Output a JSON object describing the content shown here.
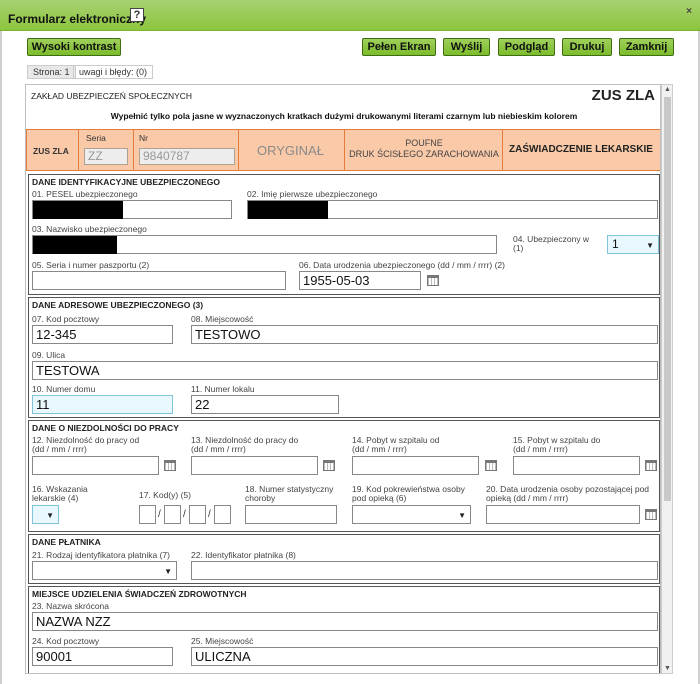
{
  "window": {
    "title": "Formularz elektroniczny",
    "help": "?",
    "close": "×"
  },
  "toolbar": {
    "high_contrast": "Wysoki kontrast",
    "fullscreen": "Pełen Ekran",
    "send": "Wyślij",
    "preview": "Podgląd",
    "print": "Drukuj",
    "close": "Zamknij"
  },
  "tabs": {
    "page": "Strona: 1",
    "errors": "uwagi i błędy: (0)"
  },
  "doc": {
    "institution": "ZAKŁAD UBEZPIECZEŃ SPOŁECZNYCH",
    "form_code": "ZUS ZLA",
    "instruction": "Wypełnić tylko pola jasne w wyznaczonych kratkach dużymi drukowanymi literami czarnym lub niebieskim kolorem"
  },
  "band": {
    "code": "ZUS ZLA",
    "seria_label": "Seria",
    "seria_value": "ZZ",
    "nr_label": "Nr",
    "nr_value": "9840787",
    "original": "ORYGINAŁ",
    "confidential_1": "POUFNE",
    "confidential_2": "DRUK ŚCISŁEGO ZARACHOWANIA",
    "certificate": "ZAŚWIADCZENIE LEKARSKIE"
  },
  "s1": {
    "title": "DANE IDENTYFIKACYJNE UBEZPIECZONEGO",
    "f01": "01. PESEL ubezpieczonego",
    "f02": "02. Imię pierwsze ubezpieczonego",
    "f03": "03. Nazwisko ubezpieczonego",
    "f04": "04. Ubezpieczony w (1)",
    "f04_value": "1",
    "f05": "05. Seria i numer paszportu (2)",
    "f06": "06. Data urodzenia ubezpieczonego (dd / mm / rrrr) (2)",
    "f06_value": "1955-05-03"
  },
  "s2": {
    "title": "DANE ADRESOWE UBEZPIECZONEGO (3)",
    "f07": "07. Kod pocztowy",
    "f07_value": "12-345",
    "f08": "08. Miejscowość",
    "f08_value": "TESTOWO",
    "f09": "09. Ulica",
    "f09_value": "TESTOWA",
    "f10": "10. Numer domu",
    "f10_value": "11",
    "f11": "11. Numer lokalu",
    "f11_value": "22"
  },
  "s3": {
    "title": "DANE O NIEZDOLNOŚCI DO PRACY",
    "f12a": "12. Niezdolność do pracy od",
    "f12b": "(dd / mm / rrrr)",
    "f13a": "13. Niezdolność do pracy do",
    "f13b": "(dd / mm / rrrr)",
    "f14a": "14. Pobyt w szpitalu od",
    "f14b": "(dd / mm / rrrr)",
    "f15a": "15. Pobyt w szpitalu do",
    "f15b": "(dd / mm / rrrr)",
    "f16a": "16. Wskazania",
    "f16b": "lekarskie (4)",
    "f17": "17. Kod(y) (5)",
    "f18a": "18. Numer statystyczny",
    "f18b": "choroby",
    "f19a": "19. Kod pokrewieństwa osoby",
    "f19b": "pod opieką (6)",
    "f20a": "20. Data urodzenia osoby pozostającej pod",
    "f20b": "opieką (dd / mm / rrrr)"
  },
  "s4": {
    "title": "DANE PŁATNIKA",
    "f21": "21. Rodzaj identyfikatora płatnika (7)",
    "f22": "22. Identyfikator płatnika (8)"
  },
  "s5": {
    "title": "MIEJSCE UDZIELENIA ŚWIADCZEŃ ZDROWOTNYCH",
    "f23": "23. Nazwa skrócona",
    "f23_value": "NAZWA NZZ",
    "f24": "24. Kod pocztowy",
    "f24_value": "90001",
    "f25": "25. Miejscowość",
    "f25_value": "ULICZNA"
  },
  "colors": {
    "accent_green": "#8cc63f",
    "band_orange": "#f9c9a8",
    "band_border": "#e57c3c",
    "field_blue": "#e8f8fe"
  }
}
